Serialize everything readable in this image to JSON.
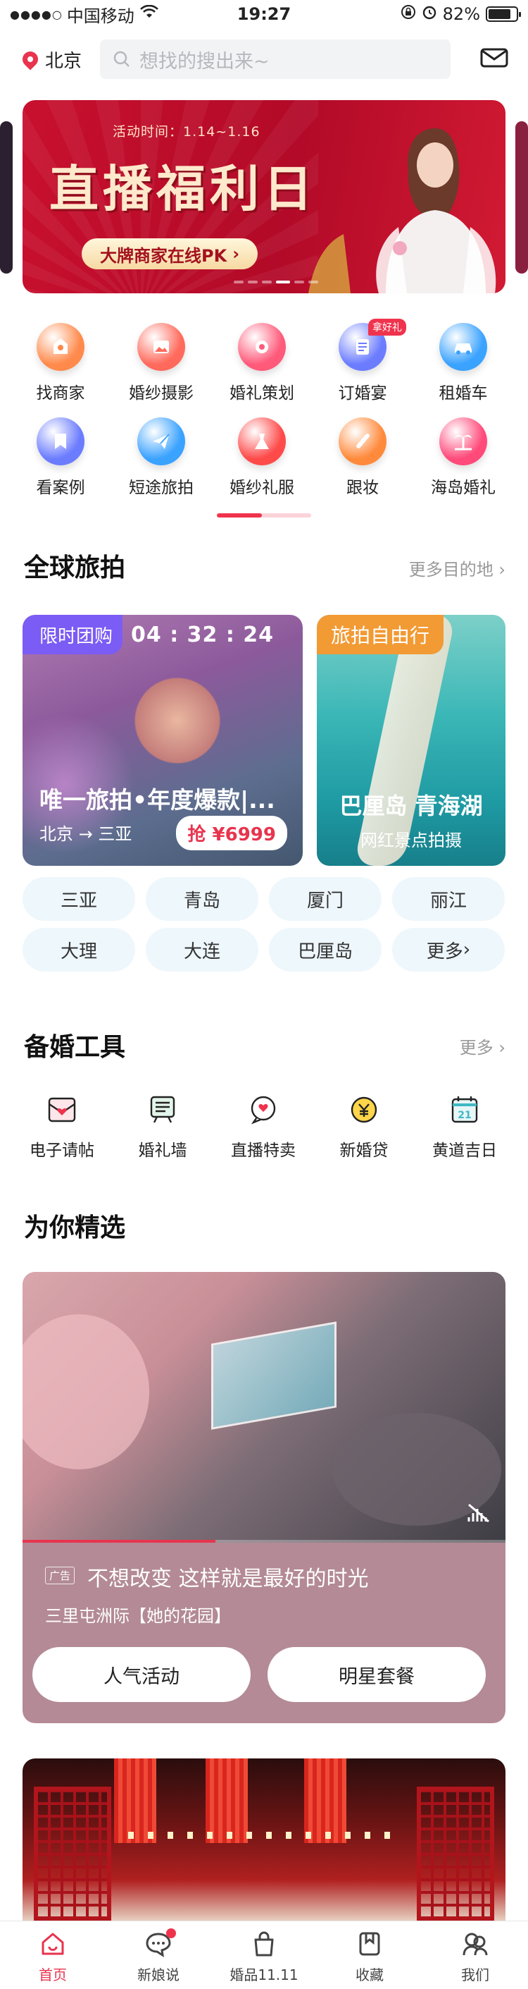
{
  "status_bar": {
    "signal": "●●●●○",
    "carrier": "中国移动",
    "time": "19:27",
    "battery": "82%",
    "battery_level": 0.82
  },
  "header": {
    "city": "北京",
    "search_placeholder": "想找的搜出来~"
  },
  "banner": {
    "time_label": "活动时间：1.14~1.16",
    "headline": "直播福利日",
    "pill": "大牌商家在线PK",
    "slide_count": 6,
    "active_slide": 3
  },
  "categories": [
    {
      "label": "找商家",
      "icon": "store-icon",
      "color": "#ff8a4c"
    },
    {
      "label": "婚纱摄影",
      "icon": "photo-icon",
      "color": "#ff6a5c"
    },
    {
      "label": "婚礼策划",
      "icon": "flower-icon",
      "color": "#ff5a7a"
    },
    {
      "label": "订婚宴",
      "icon": "banquet-icon",
      "color": "#6b7cff",
      "badge": "拿好礼"
    },
    {
      "label": "租婚车",
      "icon": "car-icon",
      "color": "#3aa2ff"
    },
    {
      "label": "看案例",
      "icon": "bookmark-icon",
      "color": "#6b7cff"
    },
    {
      "label": "短途旅拍",
      "icon": "plane-icon",
      "color": "#3aa2ff"
    },
    {
      "label": "婚纱礼服",
      "icon": "dress-icon",
      "color": "#ff4a4a"
    },
    {
      "label": "跟妆",
      "icon": "makeup-icon",
      "color": "#ff8a3c"
    },
    {
      "label": "海岛婚礼",
      "icon": "island-icon",
      "color": "#ff4a7a"
    }
  ],
  "travel": {
    "title": "全球旅拍",
    "more": "更多目的地",
    "main_card": {
      "flash_label": "限时团购",
      "countdown": "04 : 32 : 24",
      "title": "唯一旅拍•年度爆款|...",
      "route": "北京 → 三亚",
      "price": "抢 ¥6999"
    },
    "side_card": {
      "tag": "旅拍自由行",
      "title": "巴厘岛 青海湖",
      "subtitle": "网红景点拍摄"
    },
    "destinations": [
      "三亚",
      "青岛",
      "厦门",
      "丽江",
      "大理",
      "大连",
      "巴厘岛",
      "更多"
    ]
  },
  "tools": {
    "title": "备婚工具",
    "more": "更多",
    "items": [
      {
        "label": "电子请帖",
        "icon": "invitation-icon"
      },
      {
        "label": "婚礼墙",
        "icon": "wall-icon"
      },
      {
        "label": "直播特卖",
        "icon": "live-icon"
      },
      {
        "label": "新婚贷",
        "icon": "loan-icon"
      },
      {
        "label": "黄道吉日",
        "icon": "calendar-icon",
        "day": "21"
      }
    ]
  },
  "featured": {
    "title": "为你精选",
    "ad_label": "广告",
    "card_title": "不想改变 这样就是最好的时光",
    "card_subtitle": "三里屯洲际【她的花园】",
    "buttons": [
      "人气活动",
      "明星套餐"
    ],
    "video_progress": 0.4
  },
  "tabbar": [
    {
      "label": "首页",
      "icon": "home-icon",
      "active": true
    },
    {
      "label": "新娘说",
      "icon": "chat-icon",
      "badge": true
    },
    {
      "label": "婚品11.11",
      "icon": "bag-icon"
    },
    {
      "label": "收藏",
      "icon": "collect-icon"
    },
    {
      "label": "我们",
      "icon": "couple-icon"
    }
  ],
  "colors": {
    "accent": "#e8344e",
    "chip_bg": "#eef7fc",
    "flash_bg": "#7b5cf4",
    "freetravel_bg": "#f29a34"
  }
}
